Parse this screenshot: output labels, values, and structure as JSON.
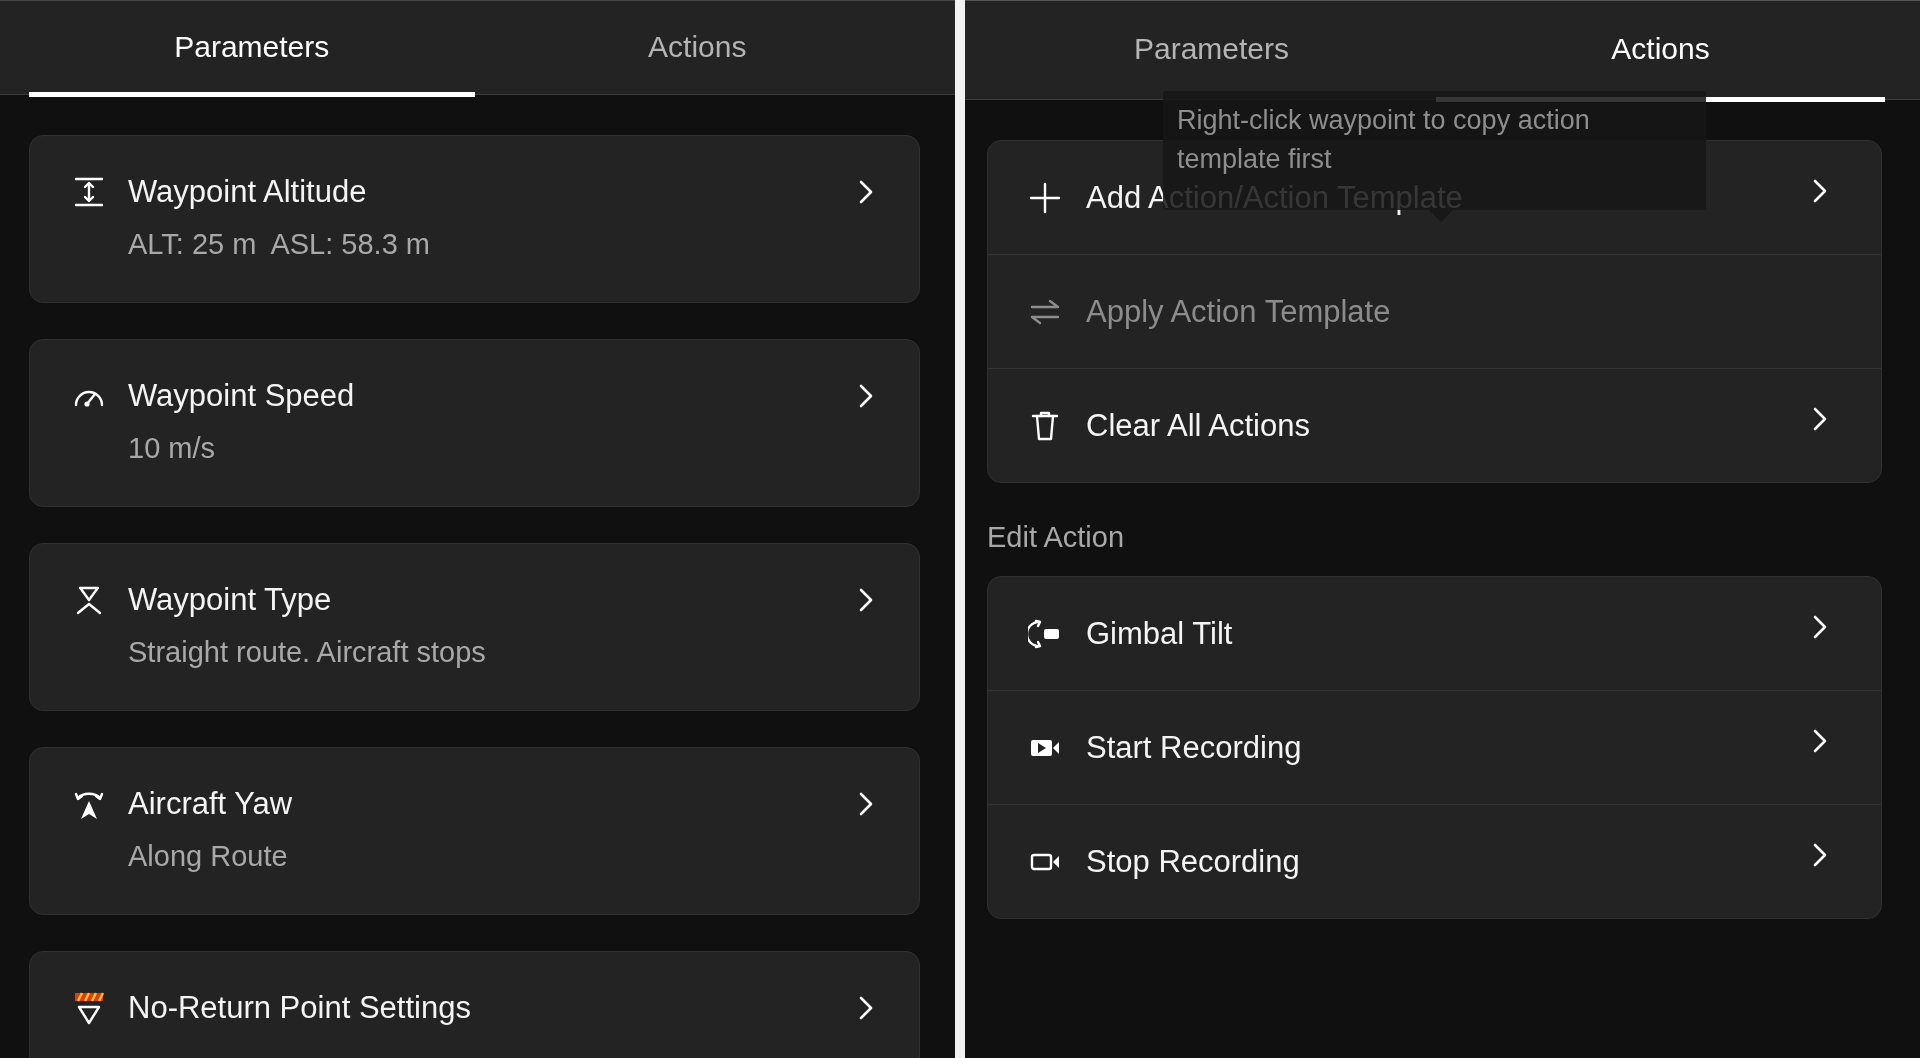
{
  "parameters_panel": {
    "tabs": [
      {
        "label": "Parameters",
        "selected": true
      },
      {
        "label": "Actions",
        "selected": false
      }
    ],
    "cards": [
      {
        "kind": "altitude",
        "title": "Waypoint Altitude",
        "values": [
          "ALT: 25 m",
          "ASL: 58.3 m"
        ]
      },
      {
        "kind": "speed",
        "title": "Waypoint Speed",
        "values": [
          "10 m/s"
        ]
      },
      {
        "kind": "type",
        "title": "Waypoint Type",
        "values": [
          "Straight route. Aircraft stops"
        ]
      },
      {
        "kind": "yaw",
        "title": "Aircraft Yaw",
        "values": [
          "Along Route"
        ]
      },
      {
        "kind": "no-return",
        "title": "No-Return Point Settings"
      }
    ]
  },
  "actions_panel": {
    "tabs": [
      {
        "label": "Parameters",
        "selected": false
      },
      {
        "label": "Actions",
        "selected": true
      }
    ],
    "tooltip": {
      "text": "Right-click waypoint to copy action template first"
    },
    "template_rows": [
      {
        "kind": "add",
        "label": "Add Action/Action Template",
        "disabled": false
      },
      {
        "kind": "apply",
        "label": "Apply Action Template",
        "disabled": true
      },
      {
        "kind": "clear",
        "label": "Clear All Actions",
        "disabled": false
      }
    ],
    "section_title": "Edit Action",
    "actions": [
      {
        "kind": "gimbal",
        "label": "Gimbal Tilt"
      },
      {
        "kind": "start-recording",
        "label": "Start Recording"
      },
      {
        "kind": "stop-recording",
        "label": "Stop Recording"
      }
    ]
  }
}
